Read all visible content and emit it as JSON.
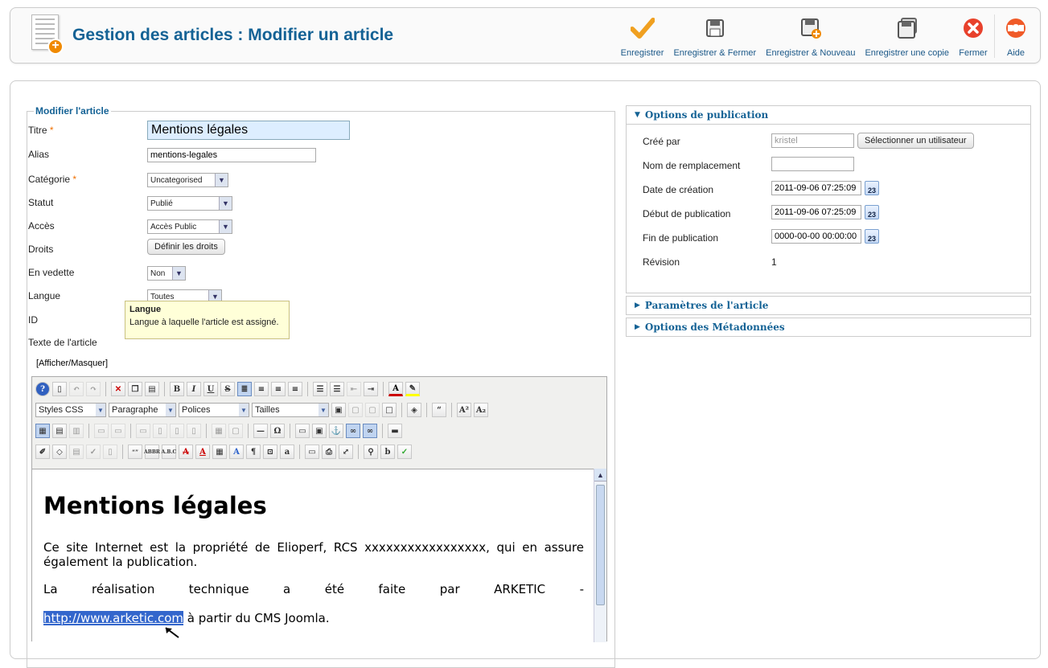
{
  "header": {
    "title": "Gestion des articles : Modifier un article",
    "toolbar": [
      {
        "label": "Enregistrer",
        "icon": "checkmark-icon"
      },
      {
        "label": "Enregistrer & Fermer",
        "icon": "save-close-icon"
      },
      {
        "label": "Enregistrer & Nouveau",
        "icon": "save-new-icon"
      },
      {
        "label": "Enregistrer une copie",
        "icon": "save-copy-icon"
      },
      {
        "label": "Fermer",
        "icon": "close-icon"
      },
      {
        "label": "Aide",
        "icon": "help-icon"
      }
    ]
  },
  "form": {
    "legend": "Modifier l'article",
    "titre": {
      "label": "Titre",
      "value": "Mentions légales"
    },
    "alias": {
      "label": "Alias",
      "value": "mentions-legales"
    },
    "categorie": {
      "label": "Catégorie",
      "value": "Uncategorised"
    },
    "statut": {
      "label": "Statut",
      "value": "Publié"
    },
    "acces": {
      "label": "Accès",
      "value": "Accès Public"
    },
    "droits": {
      "label": "Droits",
      "button": "Définir les droits"
    },
    "vedette": {
      "label": "En vedette",
      "value": "Non"
    },
    "langue": {
      "label": "Langue",
      "value": "Toutes"
    },
    "id": {
      "label": "ID"
    },
    "texte": {
      "label": "Texte de l'article"
    },
    "required_mark": "*",
    "toggle": "[Afficher/Masquer]"
  },
  "tooltip": {
    "title": "Langue",
    "text": "Langue à laquelle l'article est assigné."
  },
  "editor": {
    "styles_select": "Styles CSS",
    "format_select": "Paragraphe",
    "font_select": "Polices",
    "size_select": "Tailles",
    "heading": "Mentions légales",
    "para1": "Ce site Internet est la propriété de Elioperf, RCS xxxxxxxxxxxxxxxxx, qui en assure également la publication.",
    "para2_start": "La réalisation technique a été faite par ARKETIC -",
    "para2_link": "http://www.arketic.com",
    "para2_end": " à partir du CMS Joomla."
  },
  "publication": {
    "header": "Options de publication",
    "cree_par": {
      "label": "Créé par",
      "value": "kristel",
      "button": "Sélectionner un utilisateur"
    },
    "nom_remplacement": {
      "label": "Nom de remplacement",
      "value": ""
    },
    "date_creation": {
      "label": "Date de création",
      "value": "2011-09-06 07:25:09"
    },
    "debut_publication": {
      "label": "Début de publication",
      "value": "2011-09-06 07:25:09"
    },
    "fin_publication": {
      "label": "Fin de publication",
      "value": "0000-00-00 00:00:00"
    },
    "revision": {
      "label": "Révision",
      "value": "1"
    },
    "calendar_day": "23"
  },
  "accordion": {
    "parametres": "Paramètres de l'article",
    "metadonnees": "Options des Métadonnées"
  }
}
